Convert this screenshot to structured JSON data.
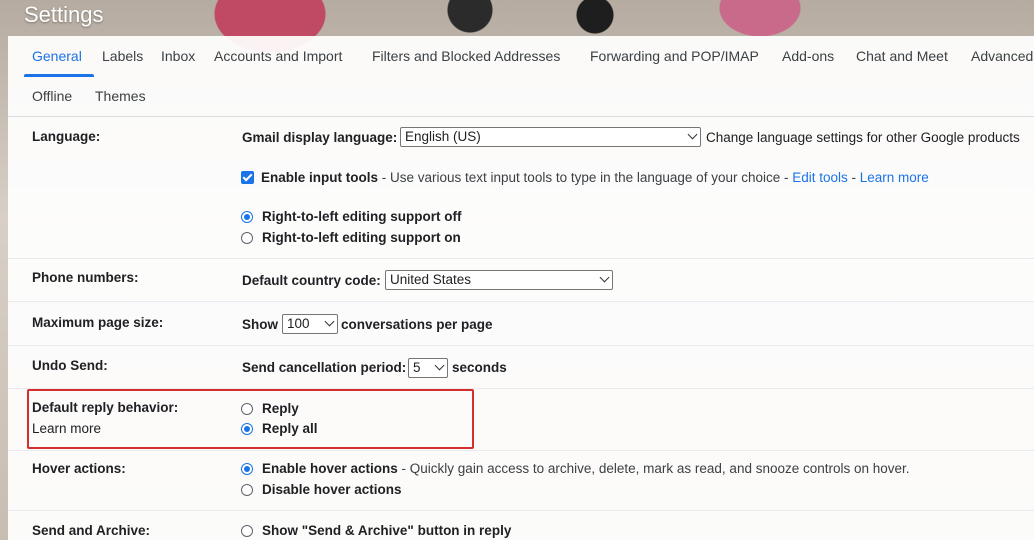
{
  "app": {
    "title": "Settings"
  },
  "tabs": [
    {
      "label": "General"
    },
    {
      "label": "Labels"
    },
    {
      "label": "Inbox"
    },
    {
      "label": "Accounts and Import"
    },
    {
      "label": "Filters and Blocked Addresses"
    },
    {
      "label": "Forwarding and POP/IMAP"
    },
    {
      "label": "Add-ons"
    },
    {
      "label": "Chat and Meet"
    },
    {
      "label": "Advanced"
    },
    {
      "label": "Offline"
    },
    {
      "label": "Themes"
    }
  ],
  "language": {
    "label": "Language:",
    "display_label": "Gmail display language:",
    "display_value": "English (US)",
    "change_link": "Change language settings for other Google products",
    "input_tools_label": "Enable input tools",
    "input_tools_desc": " - Use various text input tools to type in the language of your choice - ",
    "edit_tools": "Edit tools",
    "sep": " - ",
    "learn_more": "Learn more",
    "rtl_off": "Right-to-left editing support off",
    "rtl_on": "Right-to-left editing support on"
  },
  "phone": {
    "label": "Phone numbers:",
    "country_label": "Default country code:",
    "country_value": "United States"
  },
  "page_size": {
    "label": "Maximum page size:",
    "show": "Show",
    "value": "100",
    "suffix": "conversations per page"
  },
  "undo_send": {
    "label": "Undo Send:",
    "period_label": "Send cancellation period:",
    "value": "5",
    "suffix": "seconds"
  },
  "reply": {
    "label": "Default reply behavior:",
    "learn_more": "Learn more",
    "reply": "Reply",
    "reply_all": "Reply all"
  },
  "hover": {
    "label": "Hover actions:",
    "enable": "Enable hover actions",
    "enable_desc": " - Quickly gain access to archive, delete, mark as read, and snooze controls on hover.",
    "disable": "Disable hover actions"
  },
  "send_archive": {
    "label": "Send and Archive:",
    "show": "Show \"Send & Archive\" button in reply"
  },
  "colors": {
    "accent": "#1a73e8",
    "highlight": "#d32f2f"
  }
}
